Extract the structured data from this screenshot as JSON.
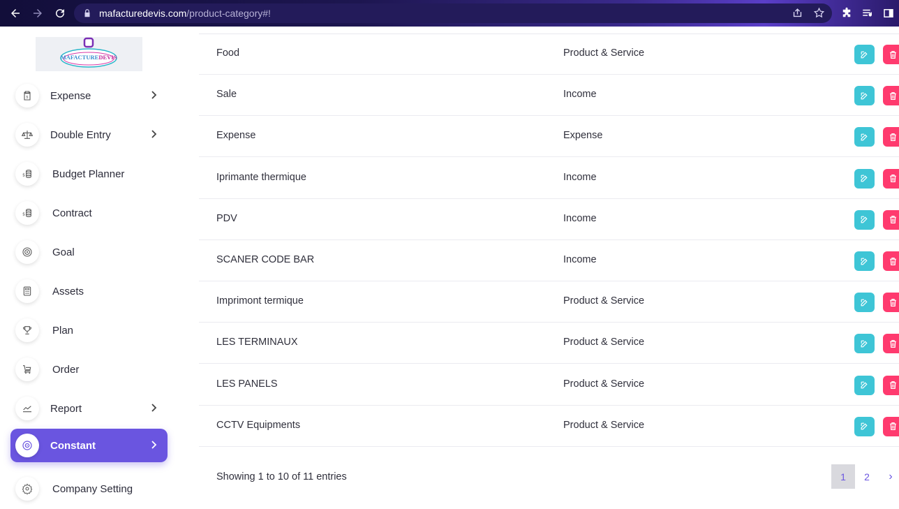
{
  "browser": {
    "url_host": "mafacturedevis.com",
    "url_path": "/product-category#!"
  },
  "logo": {
    "text": "MAFACTUREDEVIS"
  },
  "sidebar": {
    "items": [
      {
        "label": "Expense",
        "icon": "clipboard-dollar-icon",
        "has_submenu": true
      },
      {
        "label": "Double Entry",
        "icon": "scale-icon",
        "has_submenu": true
      },
      {
        "label": "Budget Planner",
        "icon": "coins-icon",
        "has_submenu": false
      },
      {
        "label": "Contract",
        "icon": "coins-icon",
        "has_submenu": false
      },
      {
        "label": "Goal",
        "icon": "target-icon",
        "has_submenu": false
      },
      {
        "label": "Assets",
        "icon": "calculator-icon",
        "has_submenu": false
      },
      {
        "label": "Plan",
        "icon": "trophy-icon",
        "has_submenu": false
      },
      {
        "label": "Order",
        "icon": "cart-icon",
        "has_submenu": false
      },
      {
        "label": "Report",
        "icon": "chart-line-icon",
        "has_submenu": true
      },
      {
        "label": "Constant",
        "icon": "disc-icon",
        "has_submenu": true,
        "active": true
      },
      {
        "label": "Company Setting",
        "icon": "gear-icon",
        "has_submenu": false
      }
    ]
  },
  "table": {
    "rows": [
      {
        "name": "Food",
        "type": "Product & Service"
      },
      {
        "name": "Sale",
        "type": "Income"
      },
      {
        "name": "Expense",
        "type": "Expense"
      },
      {
        "name": "Iprimante thermique",
        "type": "Income"
      },
      {
        "name": "PDV",
        "type": "Income"
      },
      {
        "name": "SCANER CODE BAR",
        "type": "Income"
      },
      {
        "name": "Imprimont termique",
        "type": "Product & Service"
      },
      {
        "name": "LES TERMINAUX",
        "type": "Product & Service"
      },
      {
        "name": "LES PANELS",
        "type": "Product & Service"
      },
      {
        "name": "CCTV Equipments",
        "type": "Product & Service"
      }
    ]
  },
  "footer": {
    "info": "Showing 1 to 10 of 11 entries",
    "pages": [
      "1",
      "2"
    ],
    "current_page": "1",
    "next": "›"
  },
  "colors": {
    "accent": "#6a55e0",
    "edit": "#3ec5d6",
    "delete": "#ff3a6e"
  }
}
